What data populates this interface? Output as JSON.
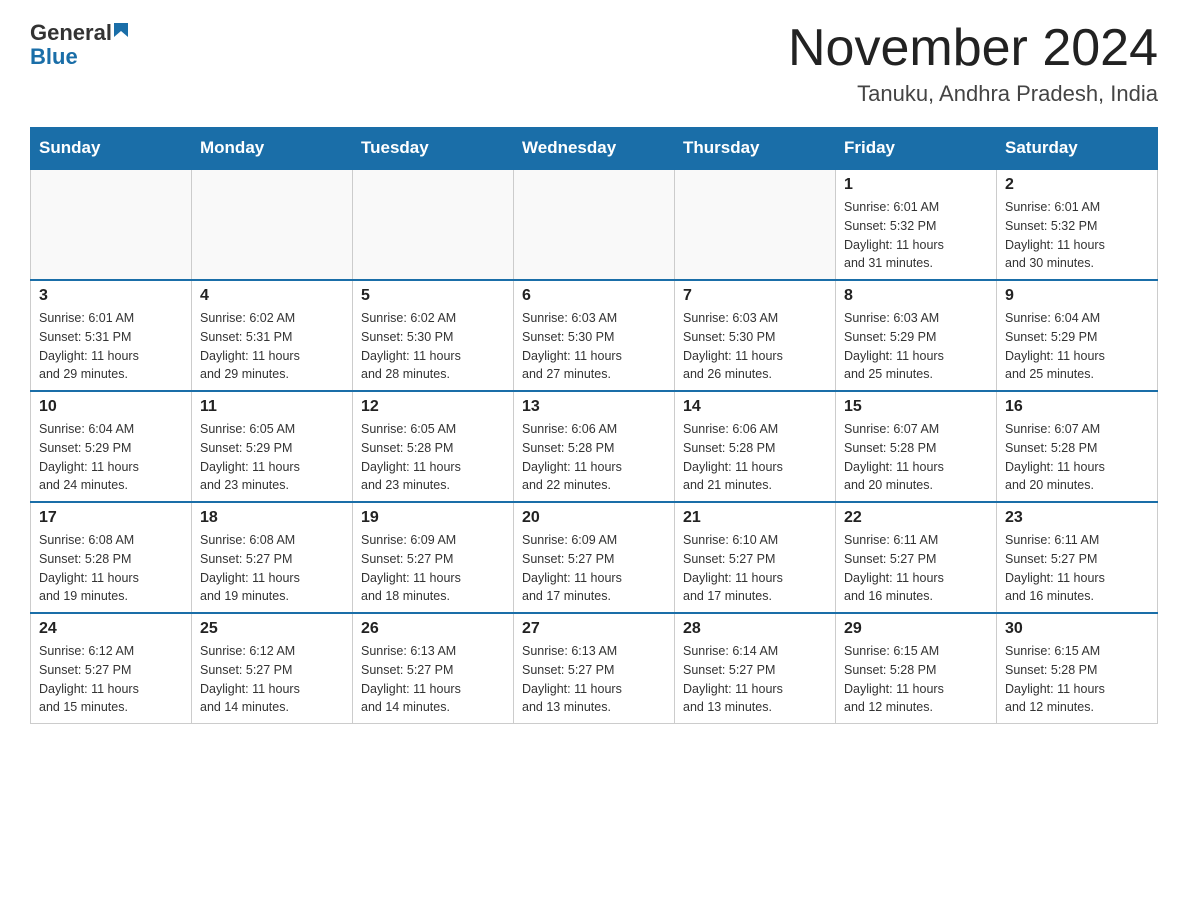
{
  "logo": {
    "general": "General",
    "blue": "Blue",
    "triangle_color": "#1a6ea8"
  },
  "header": {
    "month_year": "November 2024",
    "location": "Tanuku, Andhra Pradesh, India"
  },
  "weekdays": [
    "Sunday",
    "Monday",
    "Tuesday",
    "Wednesday",
    "Thursday",
    "Friday",
    "Saturday"
  ],
  "weeks": [
    [
      {
        "day": "",
        "info": ""
      },
      {
        "day": "",
        "info": ""
      },
      {
        "day": "",
        "info": ""
      },
      {
        "day": "",
        "info": ""
      },
      {
        "day": "",
        "info": ""
      },
      {
        "day": "1",
        "info": "Sunrise: 6:01 AM\nSunset: 5:32 PM\nDaylight: 11 hours\nand 31 minutes."
      },
      {
        "day": "2",
        "info": "Sunrise: 6:01 AM\nSunset: 5:32 PM\nDaylight: 11 hours\nand 30 minutes."
      }
    ],
    [
      {
        "day": "3",
        "info": "Sunrise: 6:01 AM\nSunset: 5:31 PM\nDaylight: 11 hours\nand 29 minutes."
      },
      {
        "day": "4",
        "info": "Sunrise: 6:02 AM\nSunset: 5:31 PM\nDaylight: 11 hours\nand 29 minutes."
      },
      {
        "day": "5",
        "info": "Sunrise: 6:02 AM\nSunset: 5:30 PM\nDaylight: 11 hours\nand 28 minutes."
      },
      {
        "day": "6",
        "info": "Sunrise: 6:03 AM\nSunset: 5:30 PM\nDaylight: 11 hours\nand 27 minutes."
      },
      {
        "day": "7",
        "info": "Sunrise: 6:03 AM\nSunset: 5:30 PM\nDaylight: 11 hours\nand 26 minutes."
      },
      {
        "day": "8",
        "info": "Sunrise: 6:03 AM\nSunset: 5:29 PM\nDaylight: 11 hours\nand 25 minutes."
      },
      {
        "day": "9",
        "info": "Sunrise: 6:04 AM\nSunset: 5:29 PM\nDaylight: 11 hours\nand 25 minutes."
      }
    ],
    [
      {
        "day": "10",
        "info": "Sunrise: 6:04 AM\nSunset: 5:29 PM\nDaylight: 11 hours\nand 24 minutes."
      },
      {
        "day": "11",
        "info": "Sunrise: 6:05 AM\nSunset: 5:29 PM\nDaylight: 11 hours\nand 23 minutes."
      },
      {
        "day": "12",
        "info": "Sunrise: 6:05 AM\nSunset: 5:28 PM\nDaylight: 11 hours\nand 23 minutes."
      },
      {
        "day": "13",
        "info": "Sunrise: 6:06 AM\nSunset: 5:28 PM\nDaylight: 11 hours\nand 22 minutes."
      },
      {
        "day": "14",
        "info": "Sunrise: 6:06 AM\nSunset: 5:28 PM\nDaylight: 11 hours\nand 21 minutes."
      },
      {
        "day": "15",
        "info": "Sunrise: 6:07 AM\nSunset: 5:28 PM\nDaylight: 11 hours\nand 20 minutes."
      },
      {
        "day": "16",
        "info": "Sunrise: 6:07 AM\nSunset: 5:28 PM\nDaylight: 11 hours\nand 20 minutes."
      }
    ],
    [
      {
        "day": "17",
        "info": "Sunrise: 6:08 AM\nSunset: 5:28 PM\nDaylight: 11 hours\nand 19 minutes."
      },
      {
        "day": "18",
        "info": "Sunrise: 6:08 AM\nSunset: 5:27 PM\nDaylight: 11 hours\nand 19 minutes."
      },
      {
        "day": "19",
        "info": "Sunrise: 6:09 AM\nSunset: 5:27 PM\nDaylight: 11 hours\nand 18 minutes."
      },
      {
        "day": "20",
        "info": "Sunrise: 6:09 AM\nSunset: 5:27 PM\nDaylight: 11 hours\nand 17 minutes."
      },
      {
        "day": "21",
        "info": "Sunrise: 6:10 AM\nSunset: 5:27 PM\nDaylight: 11 hours\nand 17 minutes."
      },
      {
        "day": "22",
        "info": "Sunrise: 6:11 AM\nSunset: 5:27 PM\nDaylight: 11 hours\nand 16 minutes."
      },
      {
        "day": "23",
        "info": "Sunrise: 6:11 AM\nSunset: 5:27 PM\nDaylight: 11 hours\nand 16 minutes."
      }
    ],
    [
      {
        "day": "24",
        "info": "Sunrise: 6:12 AM\nSunset: 5:27 PM\nDaylight: 11 hours\nand 15 minutes."
      },
      {
        "day": "25",
        "info": "Sunrise: 6:12 AM\nSunset: 5:27 PM\nDaylight: 11 hours\nand 14 minutes."
      },
      {
        "day": "26",
        "info": "Sunrise: 6:13 AM\nSunset: 5:27 PM\nDaylight: 11 hours\nand 14 minutes."
      },
      {
        "day": "27",
        "info": "Sunrise: 6:13 AM\nSunset: 5:27 PM\nDaylight: 11 hours\nand 13 minutes."
      },
      {
        "day": "28",
        "info": "Sunrise: 6:14 AM\nSunset: 5:27 PM\nDaylight: 11 hours\nand 13 minutes."
      },
      {
        "day": "29",
        "info": "Sunrise: 6:15 AM\nSunset: 5:28 PM\nDaylight: 11 hours\nand 12 minutes."
      },
      {
        "day": "30",
        "info": "Sunrise: 6:15 AM\nSunset: 5:28 PM\nDaylight: 11 hours\nand 12 minutes."
      }
    ]
  ]
}
